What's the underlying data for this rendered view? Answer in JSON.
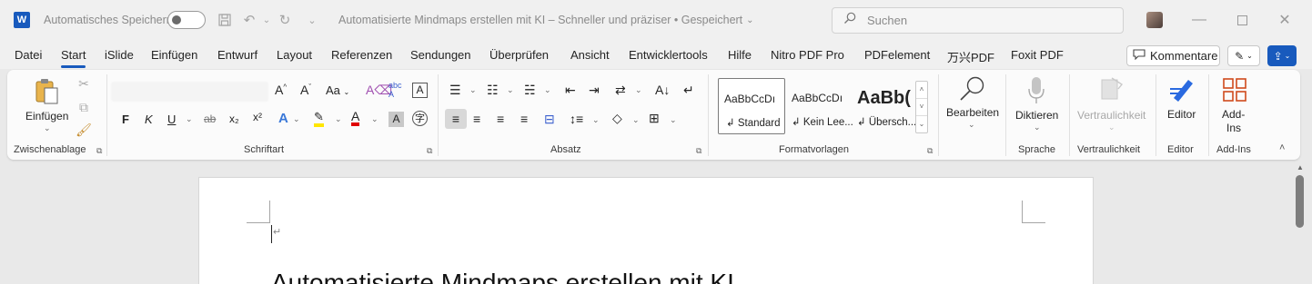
{
  "titlebar": {
    "app_logo": "W",
    "autosave_label": "Automatisches Speichern",
    "doc_title": "Automatisierte Mindmaps erstellen mit KI – Schneller und präziser • Gespeichert",
    "search_placeholder": "Suchen",
    "qat_icons": [
      "save-icon",
      "undo-icon",
      "redo-icon",
      "customize-icon"
    ],
    "window_controls": [
      "minimize-icon",
      "maximize-icon",
      "close-icon"
    ]
  },
  "tabs": [
    "Datei",
    "Start",
    "iSlide",
    "Einfügen",
    "Entwurf",
    "Layout",
    "Referenzen",
    "Sendungen",
    "Überprüfen",
    "Ansicht",
    "Entwicklertools",
    "Hilfe",
    "Nitro PDF Pro",
    "PDFelement",
    "万兴PDF",
    "Foxit PDF"
  ],
  "active_tab": "Start",
  "actions": {
    "comments_label": "Kommentare"
  },
  "ribbon": {
    "clipboard": {
      "paste_label": "Einfügen",
      "group_label": "Zwischenablage"
    },
    "font": {
      "group_label": "Schriftart",
      "bold": "F",
      "italic": "K",
      "underline": "U",
      "strike": "ab",
      "subscript": "x₂",
      "superscript": "x²"
    },
    "paragraph": {
      "group_label": "Absatz"
    },
    "styles": {
      "group_label": "Formatvorlagen",
      "items": [
        {
          "sample": "AaBbCcDı",
          "name": "↲ Standard"
        },
        {
          "sample": "AaBbCcDı",
          "name": "↲ Kein Lee..."
        },
        {
          "sample": "AaBb(",
          "name": "↲ Übersch..."
        }
      ]
    },
    "editing": {
      "label": "Bearbeiten"
    },
    "voice": {
      "label": "Diktieren",
      "group_label": "Sprache"
    },
    "sensitivity": {
      "label": "Vertraulichkeit",
      "group_label": "Vertraulichkeit"
    },
    "editor": {
      "label": "Editor",
      "group_label": "Editor"
    },
    "addins": {
      "label_line1": "Add-",
      "label_line2": "Ins",
      "group_label": "Add-Ins"
    }
  },
  "document": {
    "heading": "Automatisierte Mindmaps erstellen mit KI",
    "paragraph_mark": "↵"
  },
  "colors": {
    "accent": "#185abd",
    "highlight": "#ffe600",
    "font_color": "#e00000"
  }
}
